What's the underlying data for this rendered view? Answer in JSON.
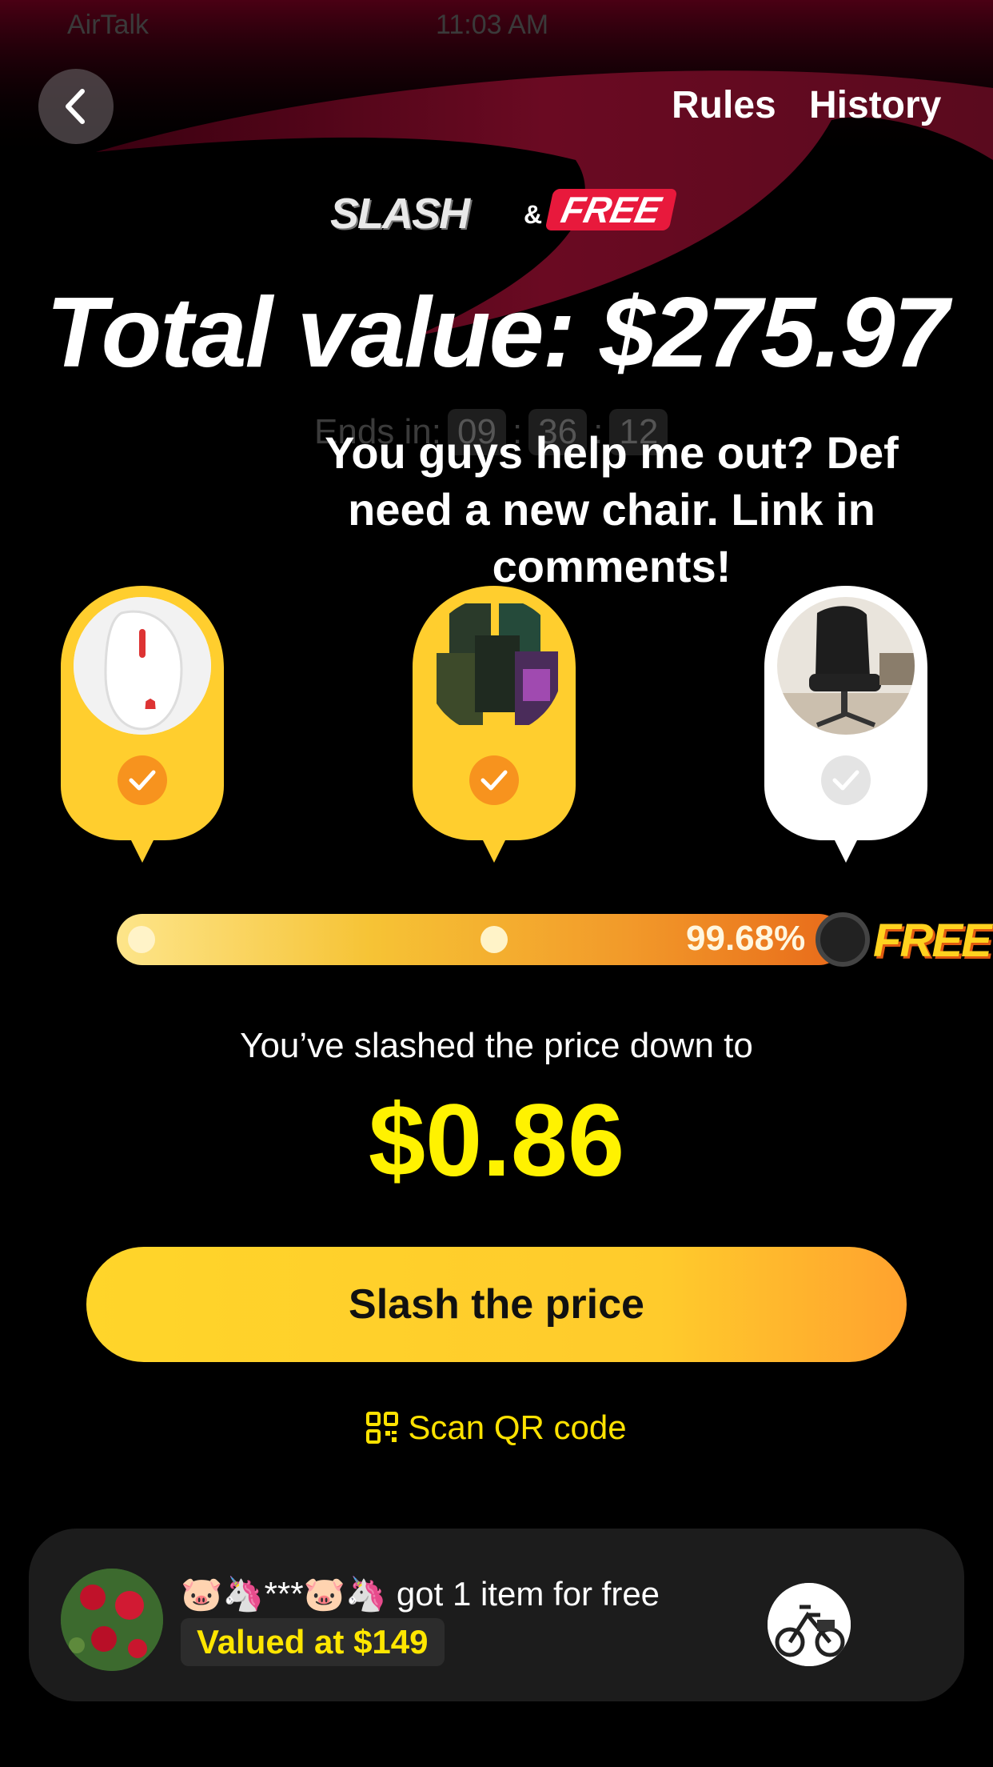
{
  "status_bar": {
    "carrier": "AirTalk",
    "time": "11:03 AM"
  },
  "header": {
    "rules_label": "Rules",
    "history_label": "History"
  },
  "logo": {
    "slash": "SLASH",
    "amp": "&",
    "free": "FREE"
  },
  "total_value": "Total value: $275.97",
  "timer": {
    "label": "Ends in:",
    "hours": "09",
    "minutes": "36",
    "seconds": "12",
    "sep": ":"
  },
  "caption": "You guys help me out? Def need a new chair. Link in comments!",
  "items": [
    {
      "name": "mouse",
      "checked": true
    },
    {
      "name": "magic-cards",
      "checked": true
    },
    {
      "name": "office-chair",
      "checked": false
    }
  ],
  "progress": {
    "percent_label": "99.68%",
    "percent": 99.68,
    "free_label": "FREE"
  },
  "slashed_label": "You’ve slashed the price down to",
  "price": "$0.86",
  "cta_label": "Slash the price",
  "scan_label": "Scan QR code",
  "winner": {
    "text": "🐷🦄***🐷🦄 got 1 item for free",
    "valued": "Valued at $149"
  },
  "colors": {
    "accent_yellow": "#ffd52a",
    "price_yellow": "#fff200",
    "checked_orange": "#f7931e",
    "background": "#000000"
  }
}
